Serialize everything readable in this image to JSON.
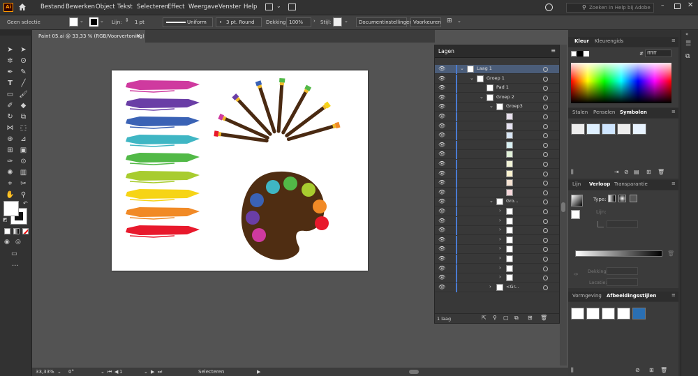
{
  "app": {
    "logo": "Ai",
    "home_icon": "home-icon"
  },
  "menu": [
    "Bestand",
    "Bewerken",
    "Object",
    "Tekst",
    "Selecteren",
    "Effect",
    "Weergave",
    "Venster",
    "Help"
  ],
  "search": {
    "placeholder": "Zoeken in Help bij Adobe"
  },
  "control": {
    "selection_label": "Geen selectie",
    "stroke_label": "Lijn:",
    "stroke_weight": "1 pt",
    "profile": "Uniform",
    "brush": "3 pt. Round",
    "opacity_label": "Dekking:",
    "opacity": "100%",
    "style_label": "Stijl:",
    "doc_settings_btn": "Documentinstellingen",
    "prefs_btn": "Voorkeuren"
  },
  "document": {
    "tab_title": "Paint 05.ai @ 33,33 % (RGB/Voorvertoning)",
    "close": "×"
  },
  "status": {
    "zoom": "33,33%",
    "rotation": "0°",
    "artboard": "1",
    "tool": "Selecteren"
  },
  "layers": {
    "title": "Lagen",
    "footer": "1 laag",
    "rows": [
      {
        "name": "Laag 1",
        "indent": 0,
        "caret": "v"
      },
      {
        "name": "Groep 1",
        "indent": 1,
        "caret": "v"
      },
      {
        "name": "Pad 1",
        "indent": 2,
        "caret": ""
      },
      {
        "name": "Groep 2",
        "indent": 2,
        "caret": "v"
      },
      {
        "name": "Groep3",
        "indent": 3,
        "caret": "v"
      },
      {
        "name": "",
        "indent": 4,
        "caret": "",
        "swatch": "#e8e0ee"
      },
      {
        "name": "",
        "indent": 4,
        "caret": "",
        "swatch": "#e6e2f2"
      },
      {
        "name": "",
        "indent": 4,
        "caret": "",
        "swatch": "#d8e6f6"
      },
      {
        "name": "",
        "indent": 4,
        "caret": "",
        "swatch": "#d9f1f3"
      },
      {
        "name": "",
        "indent": 4,
        "caret": "",
        "swatch": "#e2f2d9"
      },
      {
        "name": "",
        "indent": 4,
        "caret": "",
        "swatch": "#f2f4d7"
      },
      {
        "name": "",
        "indent": 4,
        "caret": "",
        "swatch": "#fbf3cf"
      },
      {
        "name": "",
        "indent": 4,
        "caret": "",
        "swatch": "#f6e3d2"
      },
      {
        "name": "",
        "indent": 4,
        "caret": "",
        "swatch": "#f6d7da"
      },
      {
        "name": "Gro...",
        "indent": 3,
        "caret": "v"
      },
      {
        "name": "",
        "indent": 4,
        "caret": ">"
      },
      {
        "name": "",
        "indent": 4,
        "caret": ">"
      },
      {
        "name": "",
        "indent": 4,
        "caret": ">"
      },
      {
        "name": "",
        "indent": 4,
        "caret": ">"
      },
      {
        "name": "",
        "indent": 4,
        "caret": ">"
      },
      {
        "name": "",
        "indent": 4,
        "caret": ">"
      },
      {
        "name": "",
        "indent": 4,
        "caret": ">"
      },
      {
        "name": "",
        "indent": 4,
        "caret": ">"
      },
      {
        "name": "<Gr...",
        "indent": 3,
        "caret": ">"
      }
    ]
  },
  "color_panel": {
    "tabs": [
      "Kleur",
      "Kleurengids"
    ],
    "hex_label": "#",
    "hex": "ffffff"
  },
  "symbols_panel": {
    "tabs": [
      "Stalen",
      "Penselen",
      "Symbolen"
    ]
  },
  "gradient_panel": {
    "tabs": [
      "Lijn",
      "Verloop",
      "Transparantie"
    ],
    "type_label": "Type:",
    "stroke_label": "Lijn:",
    "opacity_label": "Dekking:",
    "location_label": "Locatie:"
  },
  "appearance_panel": {
    "tabs": [
      "Vormgeving",
      "Afbeeldingsstijlen"
    ]
  },
  "colors": {
    "strokes": [
      "#cf3a9f",
      "#6a3ea6",
      "#3a62b5",
      "#3fb6c4",
      "#52b947",
      "#a8cc2f",
      "#f6d416",
      "#f18a26",
      "#e8192c"
    ],
    "brush_tips": [
      "#e8192c",
      "#cf3a9f",
      "#6a3ea6",
      "#3a62b5",
      "#52b947",
      "#52b947",
      "#f6d416",
      "#f18a26"
    ],
    "palette_dots": [
      "#3fb6c4",
      "#52b947",
      "#a8cc2f",
      "#f18a26",
      "#e8192c",
      "#3a62b5",
      "#6a3ea6",
      "#cf3a9f"
    ],
    "palette": "#4f2d12"
  }
}
